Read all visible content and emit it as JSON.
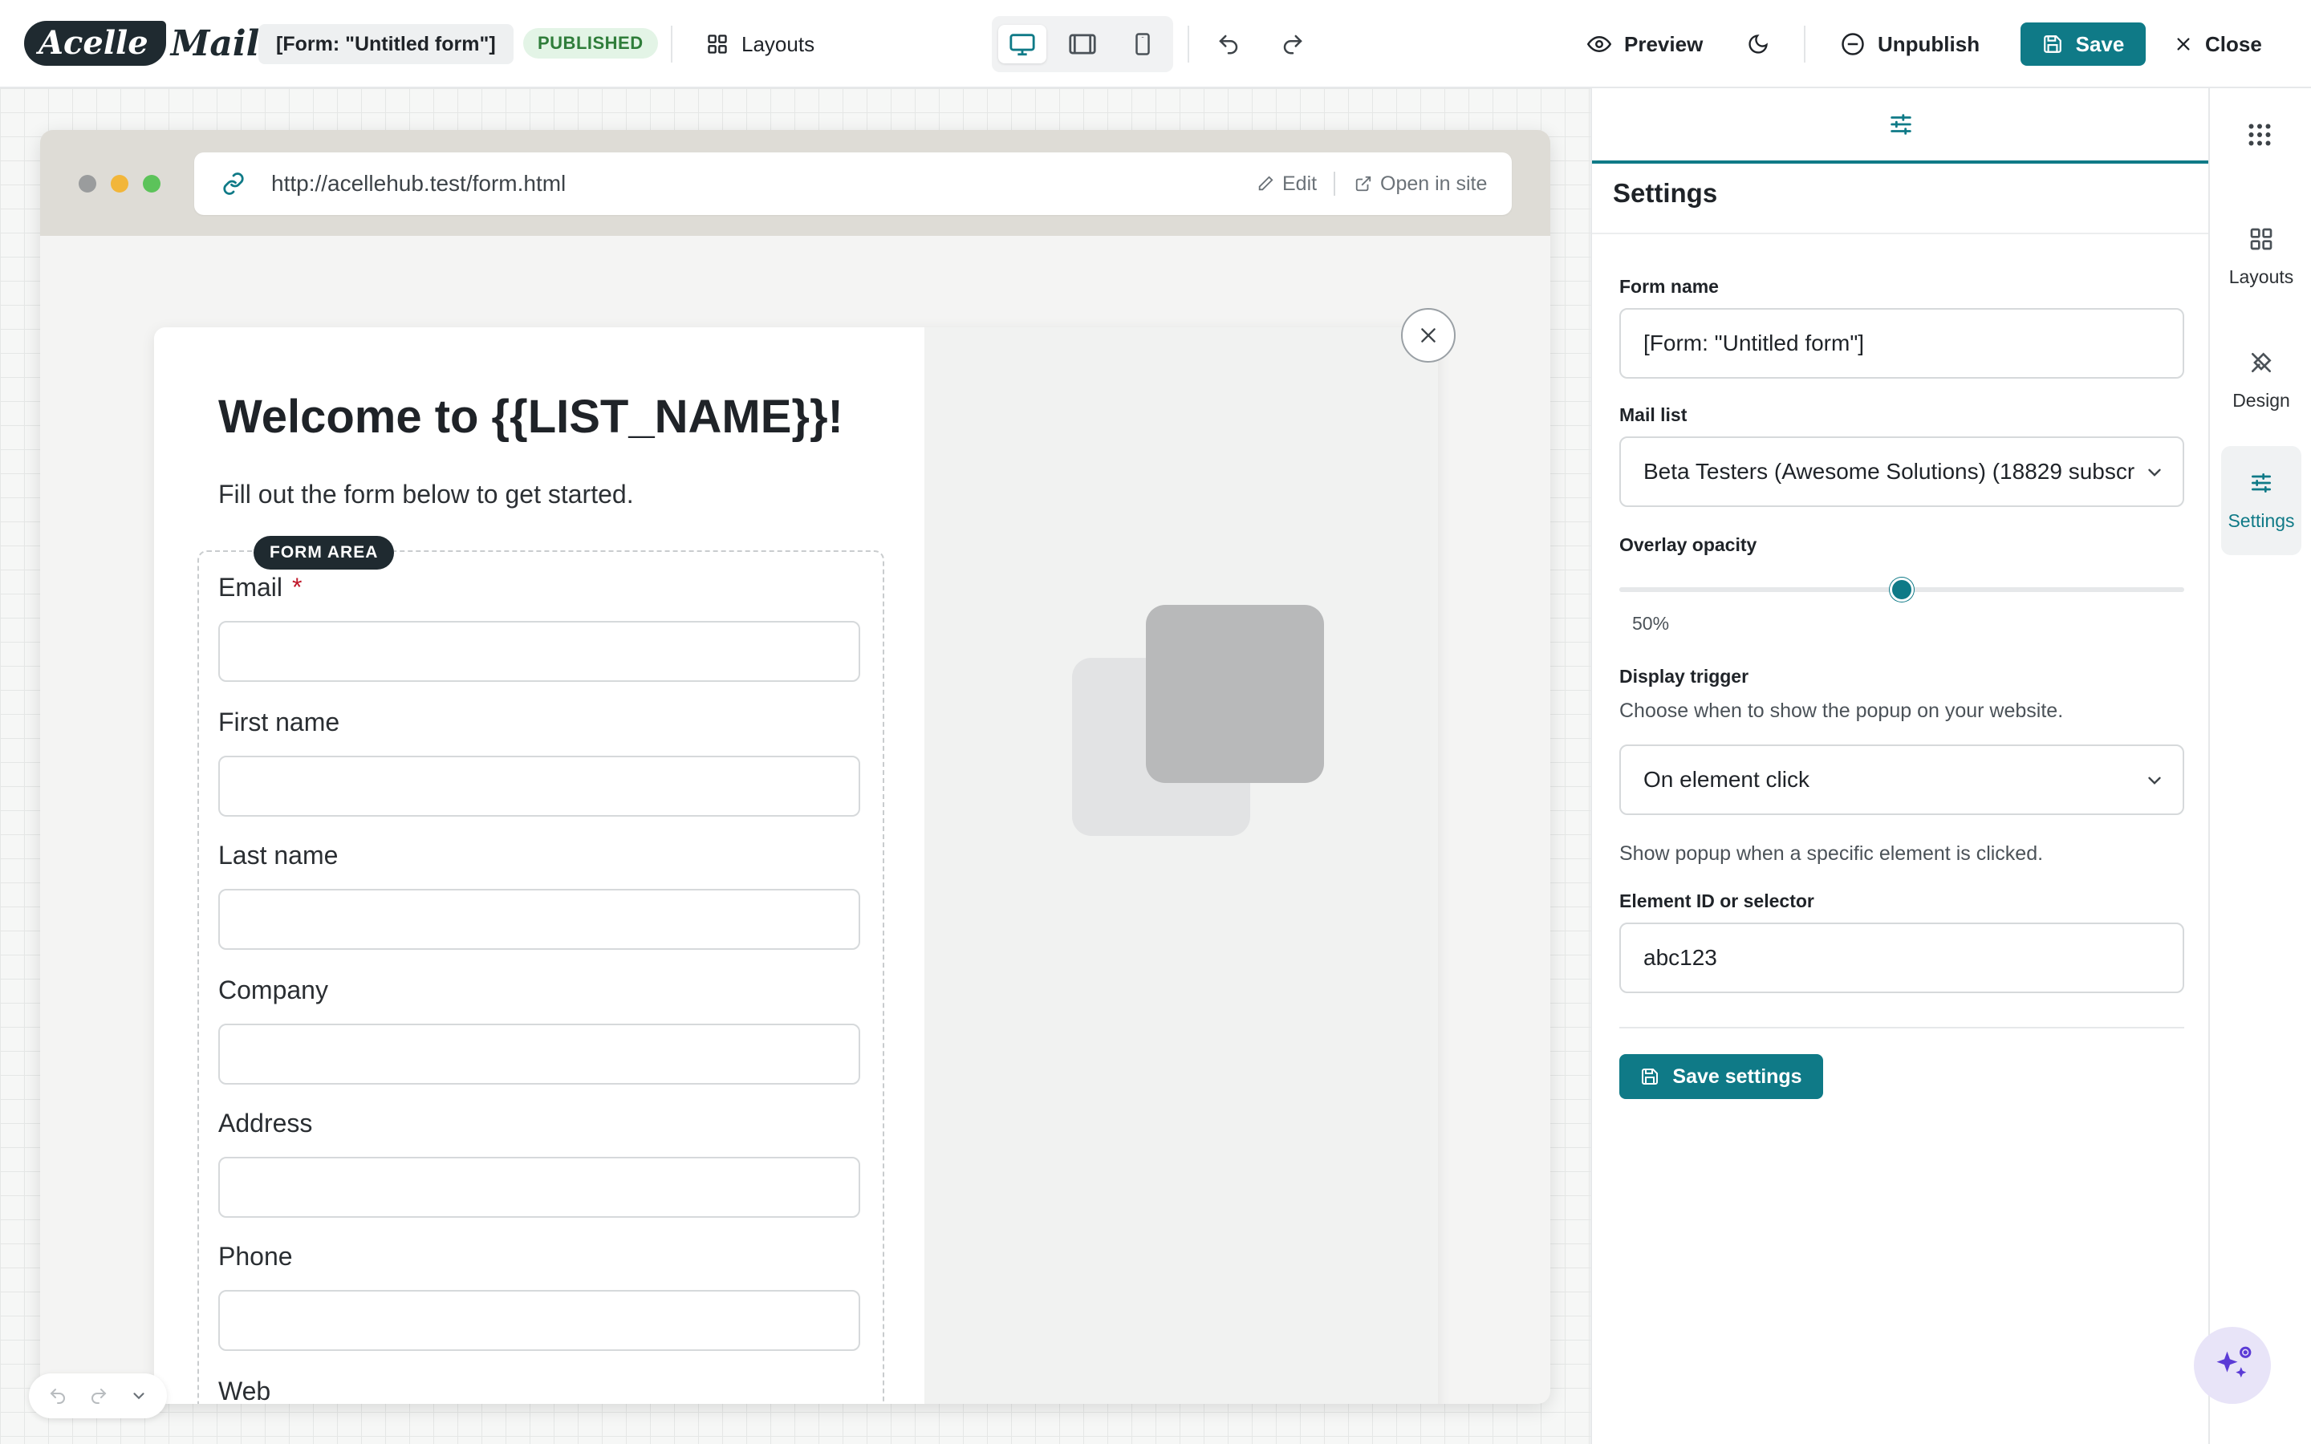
{
  "app": {
    "logo_main": "Acelle",
    "logo_rest": "Mail"
  },
  "topbar": {
    "form_name": "[Form: \"Untitled form\"]",
    "status": "PUBLISHED",
    "layouts_label": "Layouts",
    "preview_label": "Preview",
    "unpublish_label": "Unpublish",
    "save_label": "Save",
    "close_label": "Close",
    "active_device": "desktop"
  },
  "browser": {
    "url": "http://acellehub.test/form.html",
    "edit_label": "Edit",
    "open_label": "Open in site"
  },
  "popup": {
    "title": "Welcome to {{LIST_NAME}}!",
    "subtitle": "Fill out the form below to get started.",
    "form_area_badge": "FORM AREA",
    "fields": [
      {
        "label": "Email",
        "required": "*"
      },
      {
        "label": "First name"
      },
      {
        "label": "Last name"
      },
      {
        "label": "Company"
      },
      {
        "label": "Address"
      },
      {
        "label": "Phone"
      },
      {
        "label": "Web"
      }
    ]
  },
  "settings": {
    "title": "Settings",
    "form_name_label": "Form name",
    "form_name_value": "[Form: \"Untitled form\"]",
    "mail_list_label": "Mail list",
    "mail_list_value": "Beta Testers (Awesome Solutions) (18829 subscr",
    "overlay_label": "Overlay opacity",
    "overlay_value_text": "50%",
    "overlay_value": 0.5,
    "trigger_label": "Display trigger",
    "trigger_help": "Choose when to show the popup on your website.",
    "trigger_value": "On element click",
    "trigger_note": "Show popup when a specific element is clicked.",
    "selector_label": "Element ID or selector",
    "selector_value": "abc123",
    "save_settings_label": "Save settings"
  },
  "rail": {
    "items": [
      {
        "label": "Layouts",
        "icon": "layouts-icon"
      },
      {
        "label": "Design",
        "icon": "design-icon"
      },
      {
        "label": "Settings",
        "icon": "settings-sliders-icon"
      }
    ]
  },
  "colors": {
    "accent": "#0f7a87",
    "published_bg": "#e3f4e6",
    "published_text": "#2f7d3a",
    "required": "#c0182a"
  }
}
